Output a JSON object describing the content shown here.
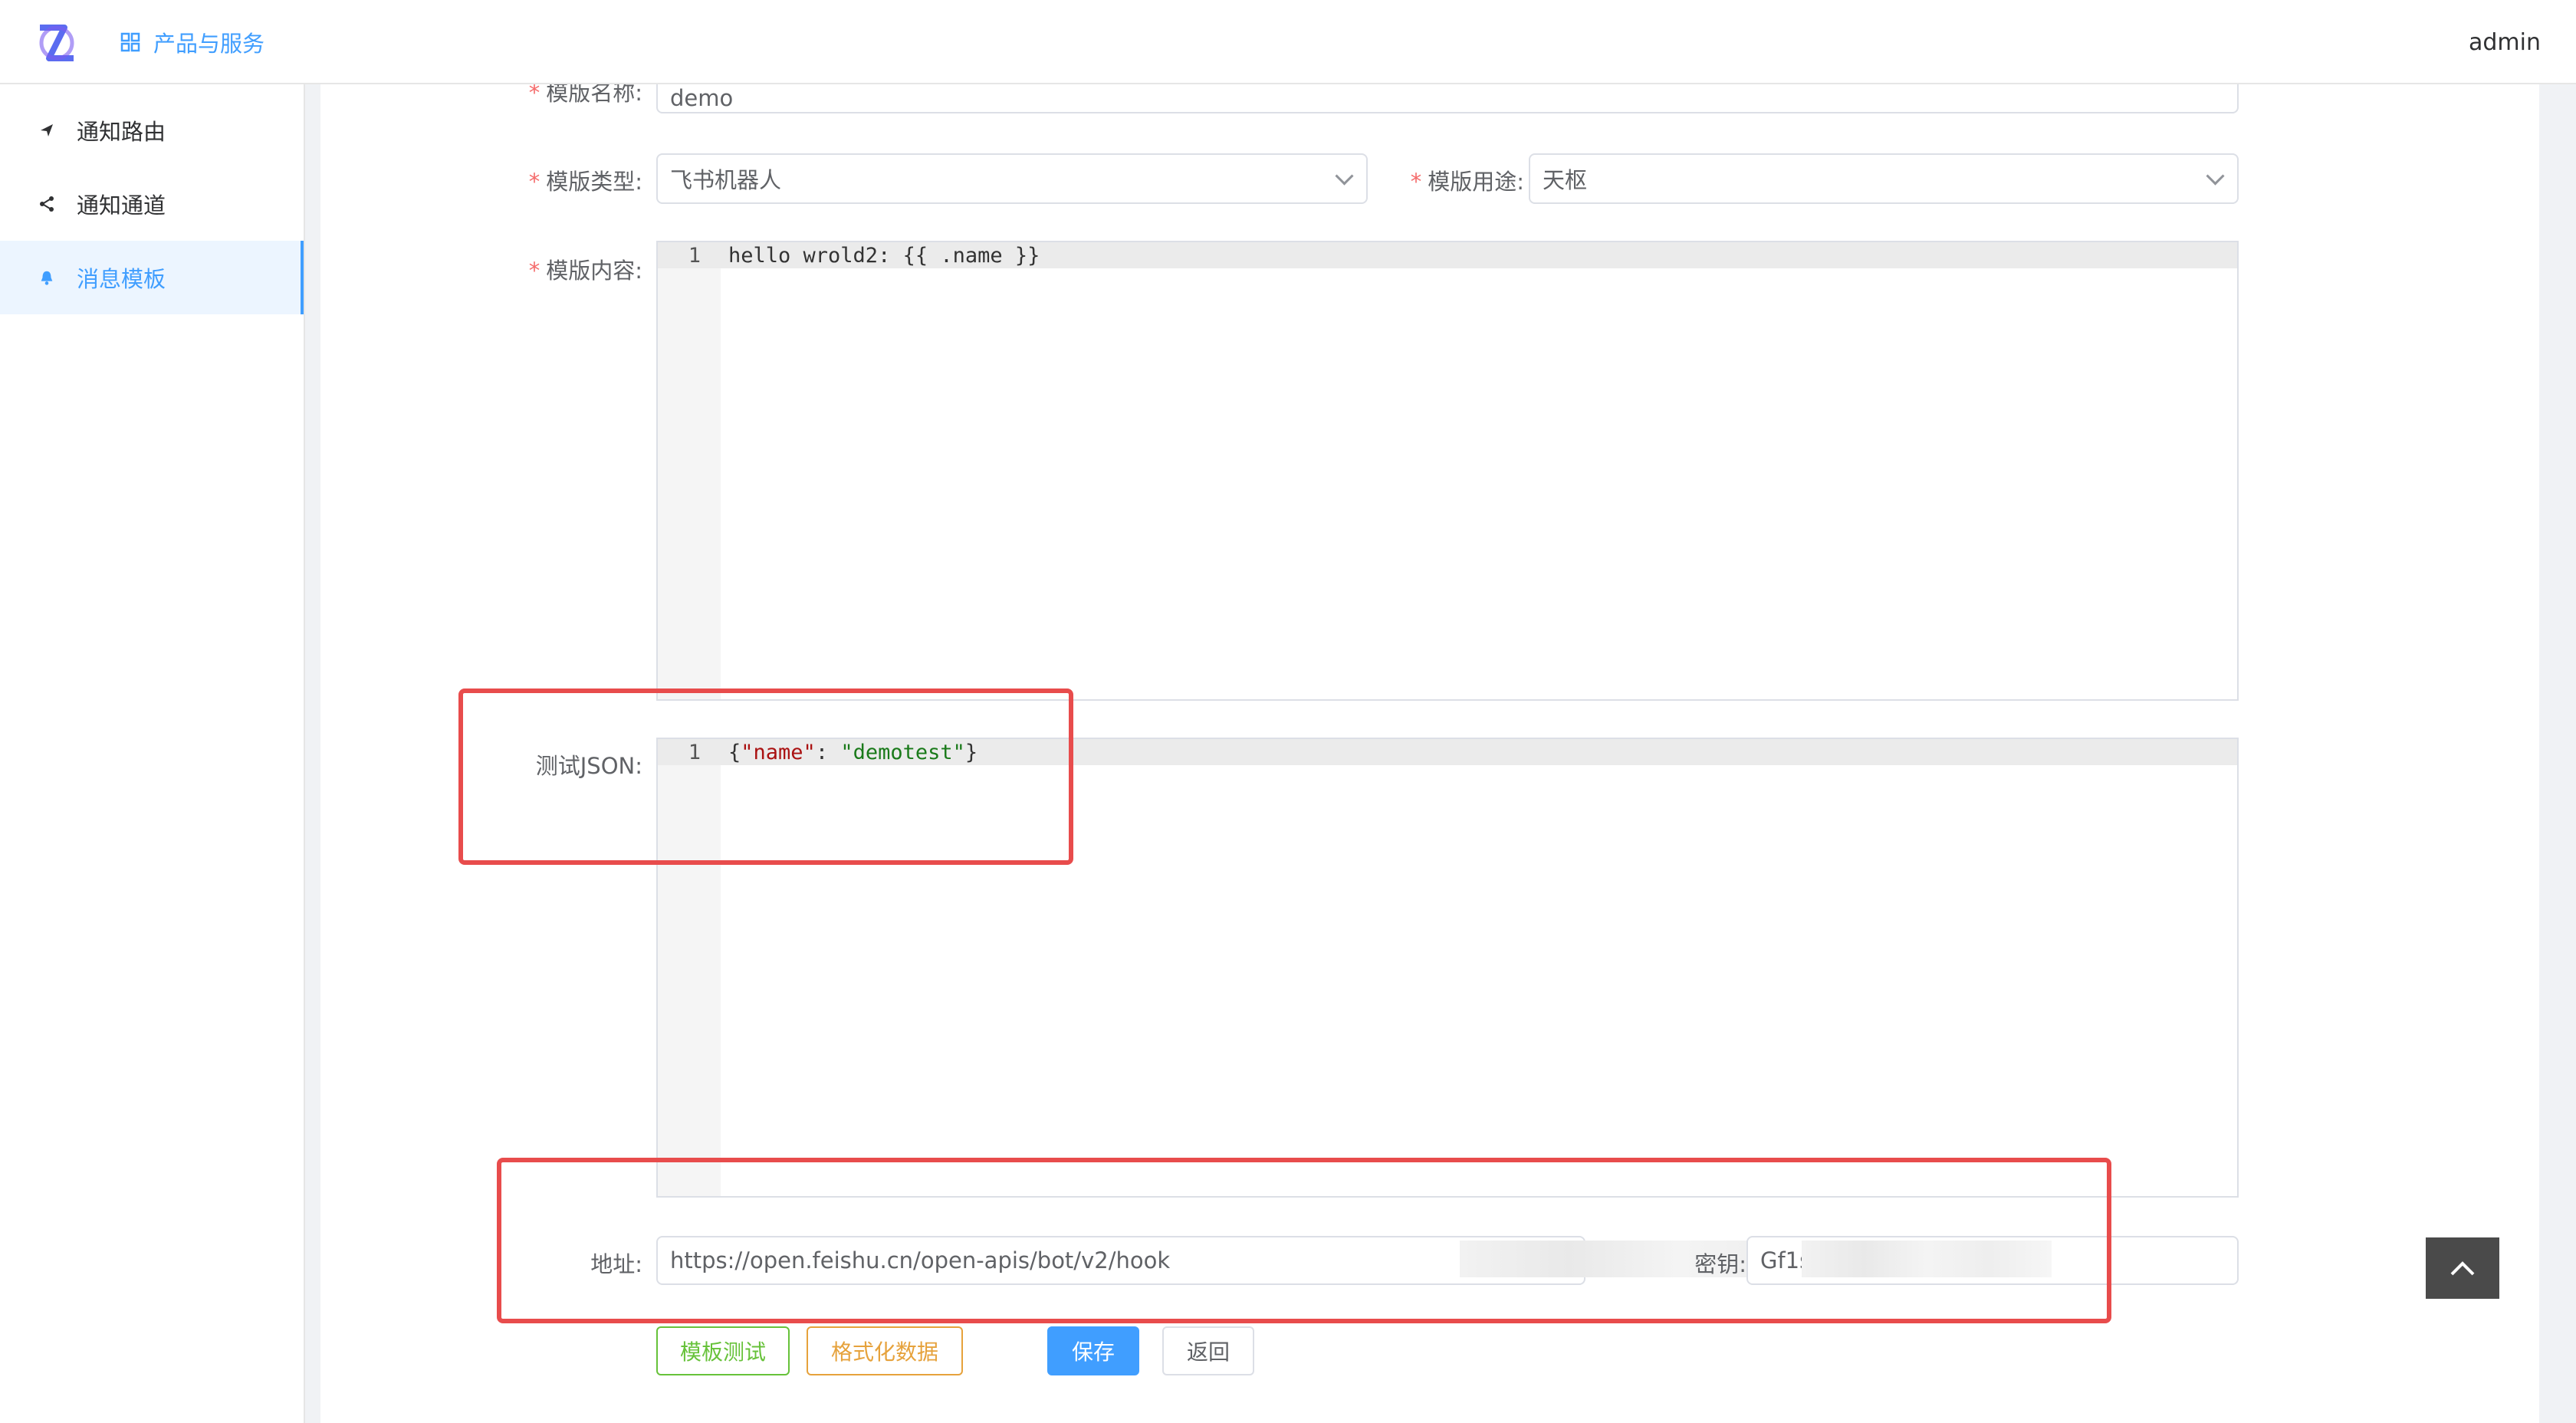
{
  "header": {
    "nav_label": "产品与服务",
    "user": "admin"
  },
  "sidebar": {
    "items": [
      {
        "label": "通知路由",
        "icon": "send-icon"
      },
      {
        "label": "通知通道",
        "icon": "share-icon"
      },
      {
        "label": "消息模板",
        "icon": "bell-icon",
        "active": true
      }
    ]
  },
  "form": {
    "name": {
      "label": "模版名称:",
      "value": "demo"
    },
    "type": {
      "label": "模版类型:",
      "value": "飞书机器人"
    },
    "usage": {
      "label": "模版用途:",
      "value": "天枢"
    },
    "content": {
      "label": "模版内容:",
      "line_number": "1",
      "code": "hello wrold2: {{ .name }}"
    },
    "test_json": {
      "label": "测试JSON:",
      "line_number": "1",
      "tokens": {
        "open": "{",
        "key": "\"name\"",
        "colon": ": ",
        "value": "\"demotest\"",
        "close": "}"
      }
    },
    "address": {
      "label": "地址:",
      "value": "https://open.feishu.cn/open-apis/bot/v2/hook"
    },
    "secret": {
      "label": "密钥:",
      "value": "Gf1s"
    }
  },
  "buttons": {
    "template_test": "模板测试",
    "format_data": "格式化数据",
    "save": "保存",
    "back": "返回"
  },
  "colors": {
    "primary": "#409eff",
    "required": "#f56c6c",
    "highlight_box": "#e84c4c",
    "success": "#67c23a",
    "warning": "#e6a23c"
  }
}
